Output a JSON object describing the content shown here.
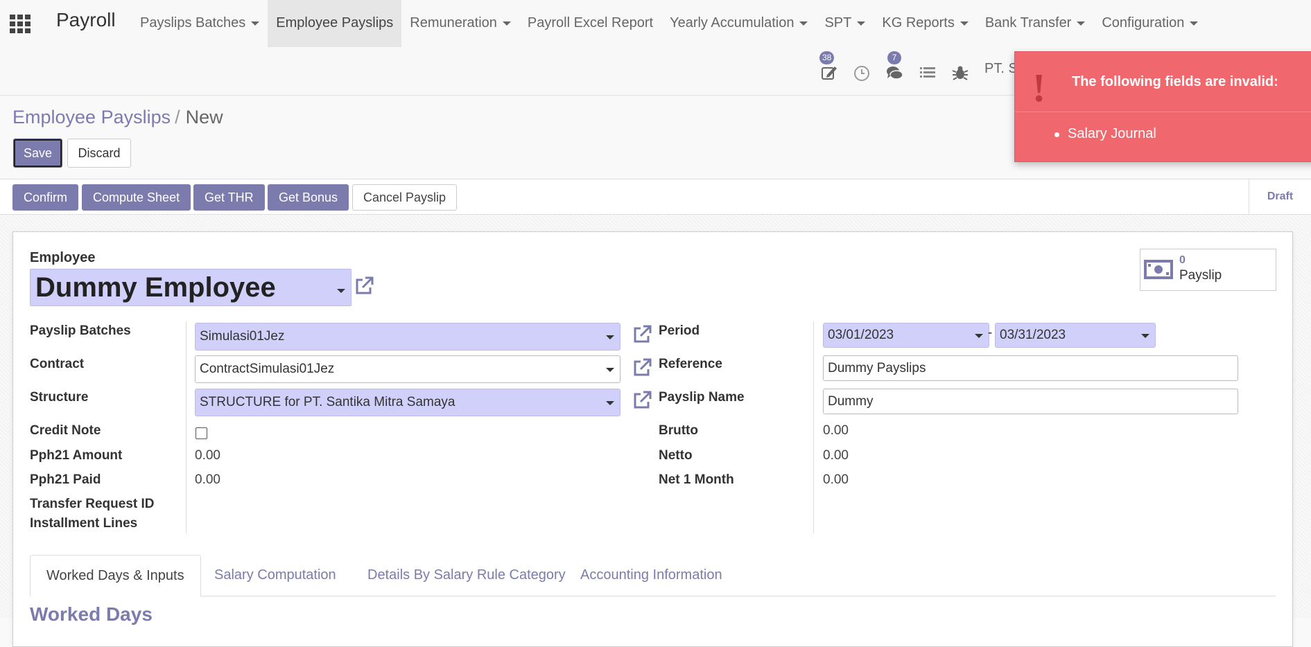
{
  "navbar": {
    "brand": "Payroll",
    "menu": [
      {
        "label": "Payslips Batches",
        "caret": true
      },
      {
        "label": "Employee Payslips",
        "caret": false,
        "active": true
      },
      {
        "label": "Remuneration",
        "caret": true
      },
      {
        "label": "Payroll Excel Report",
        "caret": false
      },
      {
        "label": "Yearly Accumulation",
        "caret": true
      },
      {
        "label": "SPT",
        "caret": true
      },
      {
        "label": "KG Reports",
        "caret": true
      },
      {
        "label": "Bank Transfer",
        "caret": true
      },
      {
        "label": "Configuration",
        "caret": true
      }
    ],
    "systray": {
      "activity_count": "38",
      "messages_count": "7",
      "company": "PT. S"
    }
  },
  "breadcrumb": {
    "parent": "Employee Payslips",
    "current": "New"
  },
  "control": {
    "save": "Save",
    "discard": "Discard"
  },
  "statusbar": {
    "buttons": [
      "Confirm",
      "Compute Sheet",
      "Get THR",
      "Get Bonus",
      "Cancel Payslip"
    ],
    "state": "Draft"
  },
  "form": {
    "employee_label": "Employee",
    "employee_name": "Dummy Employee",
    "smart_button": {
      "count": "0",
      "label": "Payslip"
    },
    "left": {
      "payslip_batches": {
        "label": "Payslip Batches",
        "value": "Simulasi01Jez"
      },
      "contract": {
        "label": "Contract",
        "value": "ContractSimulasi01Jez"
      },
      "structure": {
        "label": "Structure",
        "value": "STRUCTURE for PT. Santika Mitra Samaya"
      },
      "credit_note": {
        "label": "Credit Note"
      },
      "pph21_amount": {
        "label": "Pph21 Amount",
        "value": "0.00"
      },
      "pph21_paid": {
        "label": "Pph21 Paid",
        "value": "0.00"
      },
      "transfer_request": {
        "label": "Transfer Request ID"
      },
      "installment_lines": {
        "label": "Installment Lines"
      }
    },
    "right": {
      "period": {
        "label": "Period",
        "from": "03/01/2023",
        "sep": "-",
        "to": "03/31/2023"
      },
      "reference": {
        "label": "Reference",
        "value": "Dummy Payslips"
      },
      "payslip_name": {
        "label": "Payslip Name",
        "value": "Dummy"
      },
      "brutto": {
        "label": "Brutto",
        "value": "0.00"
      },
      "netto": {
        "label": "Netto",
        "value": "0.00"
      },
      "net_1_month": {
        "label": "Net 1 Month",
        "value": "0.00"
      }
    }
  },
  "tabs": [
    "Worked Days & Inputs",
    "Salary Computation",
    "Details By Salary Rule Category",
    "Accounting Information"
  ],
  "section_title": "Worked Days",
  "notification": {
    "title": "The following fields are invalid:",
    "items": [
      "Salary Journal"
    ]
  },
  "colors": {
    "primary": "#7c7bad",
    "required_field": "#d1d0fa",
    "danger": "#f0686e"
  }
}
